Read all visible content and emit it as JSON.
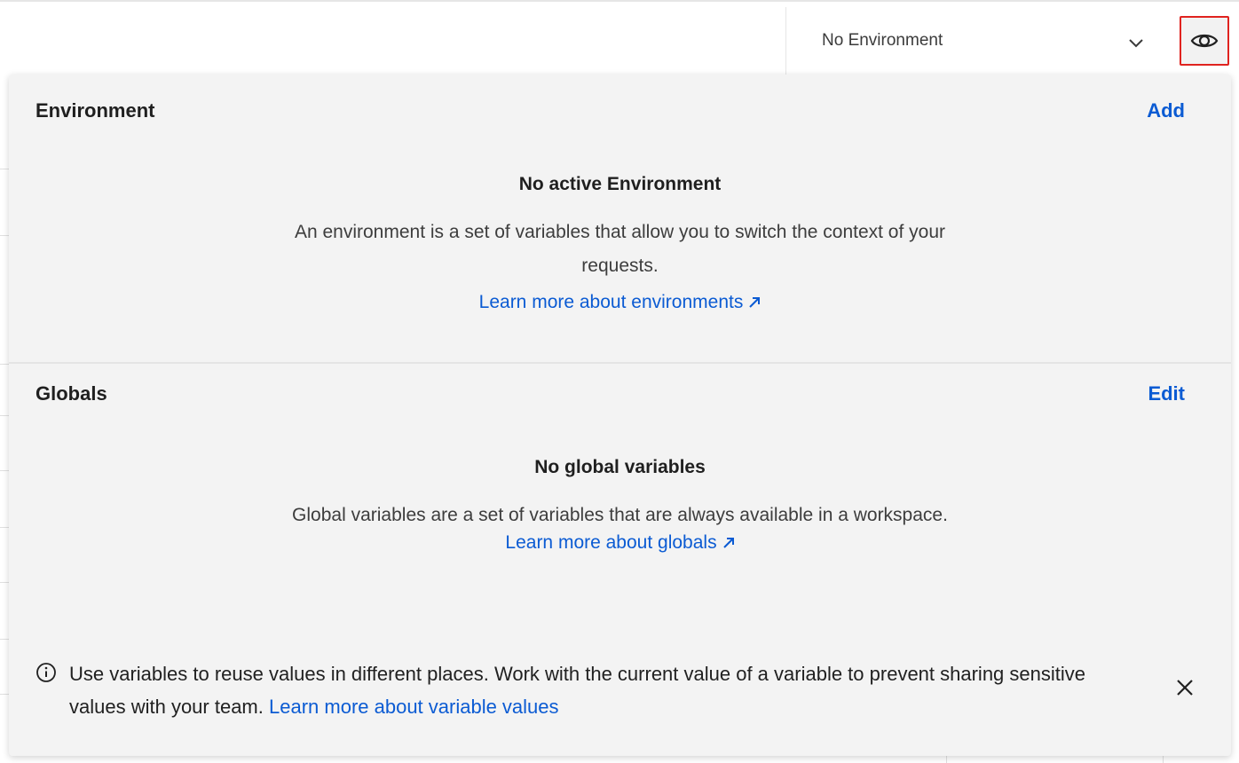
{
  "topbar": {
    "environment_select": {
      "value": "No Environment"
    },
    "quick_look_icon": "eye-icon"
  },
  "environment": {
    "title": "Environment",
    "action": "Add",
    "empty_title": "No active Environment",
    "empty_description": "An environment is a set of variables that allow you to switch the context of your requests.",
    "learn_more": "Learn more about environments"
  },
  "globals": {
    "title": "Globals",
    "action": "Edit",
    "empty_title": "No global variables",
    "empty_description": "Global variables are a set of variables that are always available in a workspace.",
    "learn_more": "Learn more about globals"
  },
  "banner": {
    "text": "Use variables to reuse values in different places. Work with the current value of a variable to prevent sharing sensitive values with your team.",
    "link": "Learn more about variable values"
  },
  "colors": {
    "link": "#0b5bd3",
    "highlight_border": "#e0231f",
    "panel_bg": "#f3f3f3"
  }
}
